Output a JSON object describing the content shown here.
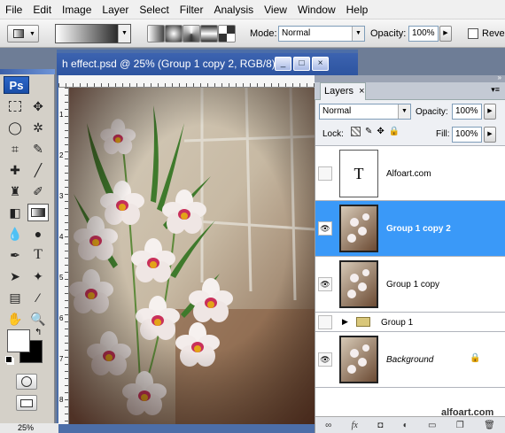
{
  "menu": [
    "File",
    "Edit",
    "Image",
    "Layer",
    "Select",
    "Filter",
    "Analysis",
    "View",
    "Window",
    "Help"
  ],
  "options": {
    "mode_label": "Mode:",
    "mode_value": "Normal",
    "opacity_label": "Opacity:",
    "opacity_value": "100%",
    "reverse_label": "Rever"
  },
  "document": {
    "title": "h effect.psd @ 25% (Group 1 copy 2, RGB/8)",
    "zoom": "25%",
    "ruler_v_digits": [
      "1",
      "2",
      "3",
      "4",
      "5",
      "6",
      "7",
      "8"
    ],
    "window_buttons": [
      "_",
      "□",
      "×"
    ]
  },
  "toolbox": {
    "logo": "Ps"
  },
  "layers_panel": {
    "tab_label": "Layers",
    "tab_close": "×",
    "blend_mode": "Normal",
    "opacity_label": "Opacity:",
    "opacity_value": "100%",
    "lock_label": "Lock:",
    "fill_label": "Fill:",
    "fill_value": "100%",
    "layers": [
      {
        "name": "Alfoart.com",
        "type": "text",
        "visible": false,
        "selected": false,
        "thumb_glyph": "T"
      },
      {
        "name": "Group 1 copy 2",
        "type": "image",
        "visible": true,
        "selected": true
      },
      {
        "name": "Group 1 copy",
        "type": "image",
        "visible": true,
        "selected": false
      },
      {
        "name": "Group 1",
        "type": "group",
        "visible": false,
        "selected": false
      },
      {
        "name": "Background",
        "type": "image",
        "visible": true,
        "selected": false,
        "locked": true
      }
    ]
  },
  "watermark": "alfoart.com",
  "colors": {
    "selected_layer": "#3a99f8",
    "title_bar": "#2d54a0"
  }
}
